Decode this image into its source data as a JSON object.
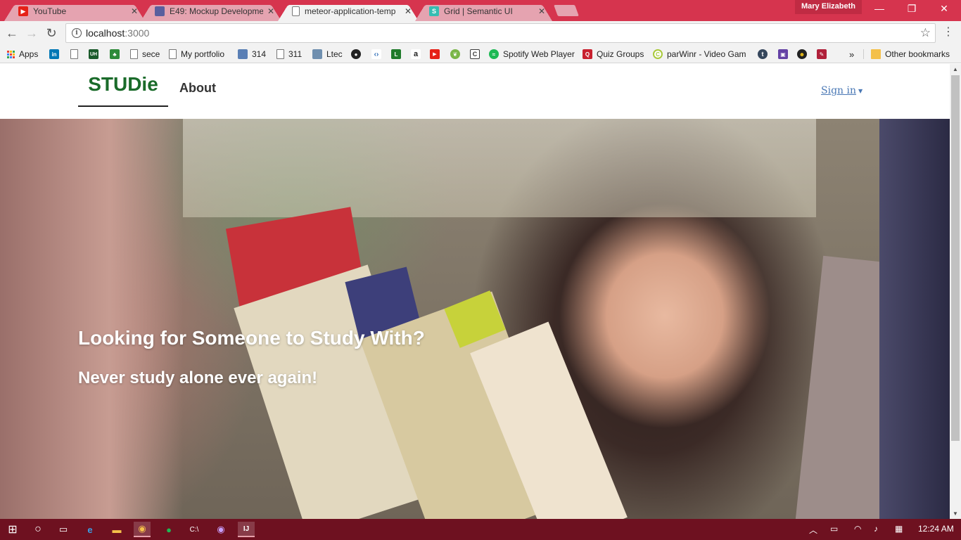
{
  "browser": {
    "tabs": [
      {
        "title": "YouTube",
        "icon": "youtube-icon",
        "icon_color": "#e62117"
      },
      {
        "title": "E49: Mockup Developme",
        "icon": "app-square-icon",
        "icon_color": "#5a5f9e"
      },
      {
        "title": "meteor-application-temp",
        "icon": "document-icon",
        "icon_color": "#ffffff",
        "active": true
      },
      {
        "title": "Grid | Semantic UI",
        "icon": "semantic-s-icon",
        "icon_color": "#35bdb2"
      }
    ],
    "profile_name": "Mary Elizabeth",
    "address": {
      "host": "localhost",
      "port": ":3000"
    },
    "bookmarks": [
      {
        "label": "Apps",
        "icon": "apps-grid-icon"
      },
      {
        "label": "",
        "icon": "linkedin-icon",
        "color": "#0077b5",
        "glyph": "in"
      },
      {
        "label": "",
        "icon": "document-icon"
      },
      {
        "label": "",
        "icon": "uh-icon",
        "color": "#1a5a2a",
        "glyph": "UH"
      },
      {
        "label": "",
        "icon": "leaf-icon",
        "color": "#2e8b3a",
        "glyph": "♣"
      },
      {
        "label": "sece",
        "icon": "document-icon"
      },
      {
        "label": "My portfolio",
        "icon": "document-icon"
      },
      {
        "label": "314",
        "icon": "square-app-icon",
        "color": "#5a7fb5"
      },
      {
        "label": "311",
        "icon": "document-icon"
      },
      {
        "label": "Ltec",
        "icon": "monitor-icon",
        "color": "#6f8faf"
      },
      {
        "label": "",
        "icon": "github-icon",
        "color": "#222222",
        "glyph": "●"
      },
      {
        "label": "",
        "icon": "code-icon",
        "color": "#2a6ab5",
        "glyph": "‹›"
      },
      {
        "label": "",
        "icon": "laulima-icon",
        "color": "#1f7a2a",
        "glyph": "L"
      },
      {
        "label": "",
        "icon": "amazon-icon",
        "color": "#ff9900",
        "glyph": "a"
      },
      {
        "label": "",
        "icon": "youtube-icon",
        "color": "#e62117",
        "glyph": "▶"
      },
      {
        "label": "",
        "icon": "leaf-icon",
        "color": "#7ab648",
        "glyph": "❦"
      },
      {
        "label": "",
        "icon": "c-icon",
        "color": "#3a3a3a",
        "glyph": "C"
      },
      {
        "label": "Spotify Web Player",
        "icon": "spotify-icon",
        "color": "#1db954",
        "glyph": "≈"
      },
      {
        "label": "Quiz Groups",
        "icon": "quiz-groups-icon",
        "color": "#c8202e",
        "glyph": "Q"
      },
      {
        "label": "parWinr - Video Gam",
        "icon": "parwinr-icon",
        "color": "#a9c93a",
        "glyph": "C"
      },
      {
        "label": "",
        "icon": "tumblr-icon",
        "color": "#35465c",
        "glyph": "t"
      },
      {
        "label": "",
        "icon": "twitch-icon",
        "color": "#6441a5",
        "glyph": "▣"
      },
      {
        "label": "",
        "icon": "kirby-icon",
        "color": "#222222",
        "glyph": "☻"
      },
      {
        "label": "",
        "icon": "quill-icon",
        "color": "#b0203a",
        "glyph": "✎"
      }
    ],
    "more_bookmarks": "»",
    "other_bookmarks": "Other bookmarks"
  },
  "site": {
    "brand": "STUDie",
    "nav_about": "About",
    "signin": "Sign in",
    "hero_title": "Looking for Someone to Study With?",
    "hero_subtitle": "Never study alone ever again!"
  },
  "taskbar": {
    "time": "12:24 AM"
  }
}
